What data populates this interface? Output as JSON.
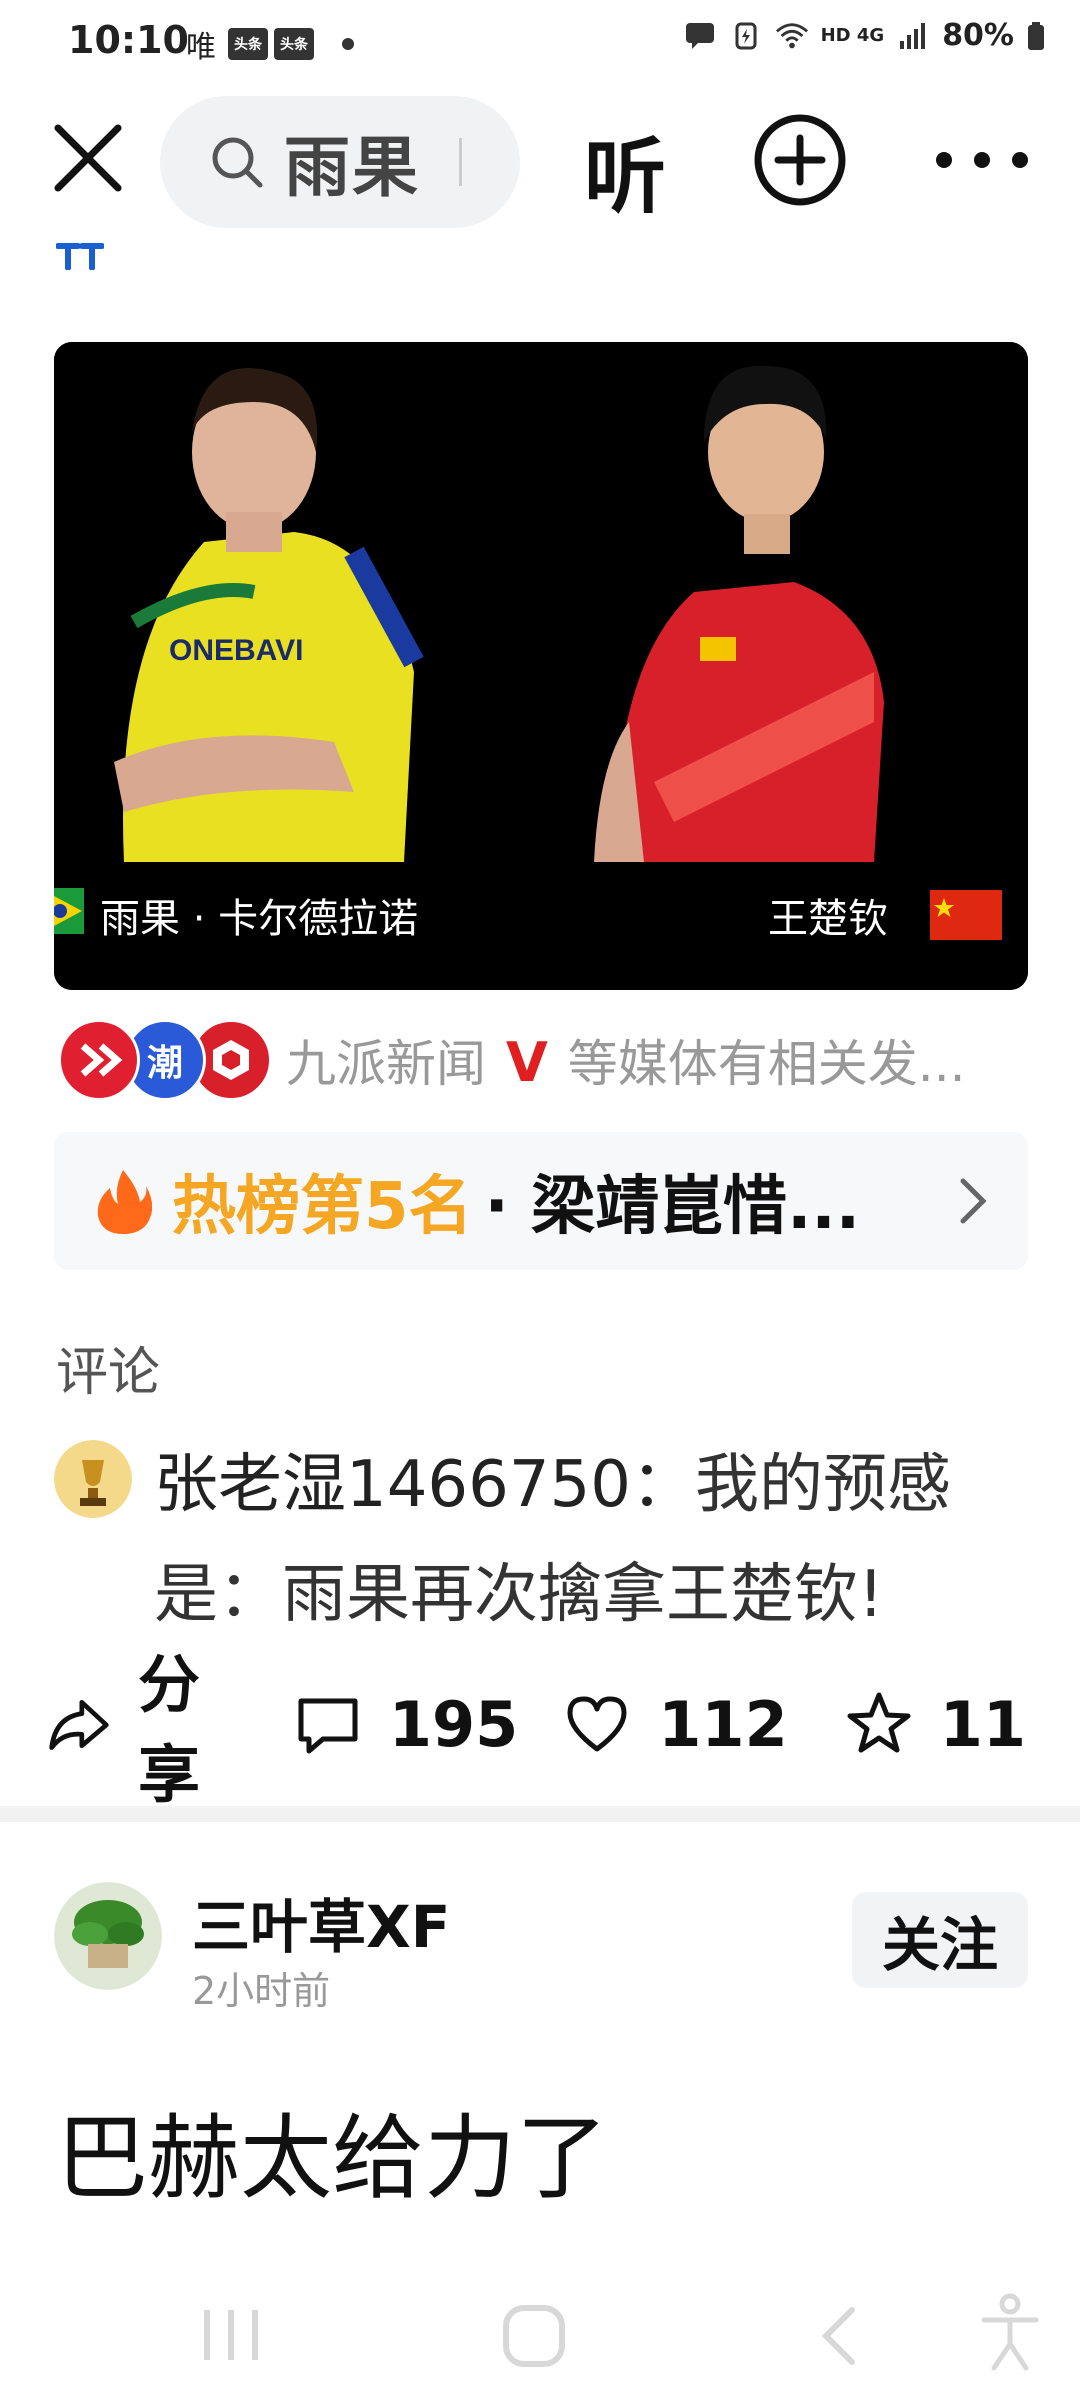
{
  "status_bar": {
    "time": "10:10",
    "carrier_label": "唯",
    "badge_1": "头条",
    "badge_2": "头条",
    "network": "HD 4G",
    "battery": "80%"
  },
  "top_nav": {
    "search_text": "雨果",
    "listen_label": "听"
  },
  "photo": {
    "left_name": "雨果 · 卡尔德拉诺",
    "right_name": "王楚钦",
    "jersey_text": "ONEBAVI"
  },
  "media": {
    "logo2_text": "潮",
    "sources_text": "九派新闻",
    "v_mark": "V",
    "suffix_text": "等媒体有相关发..."
  },
  "hot": {
    "rank_label": "热榜第5名",
    "title": "· 梁靖崑惜..."
  },
  "comments": {
    "label": "评论",
    "user": "张老湿1466750：",
    "text": "我的预感是：雨果再次擒拿王楚钦!"
  },
  "actions": {
    "share_label": "分享",
    "comment_count": "195",
    "like_count": "112",
    "favorite_count": "11"
  },
  "post": {
    "author": "三叶草XF",
    "time": "2小时前",
    "follow_label": "关注",
    "body": "巴赫太给力了"
  },
  "colors": {
    "accent_orange": "#f5a623",
    "v_red": "#e02020",
    "jersey_yellow": "#e8e020",
    "jersey_red": "#d8202a"
  }
}
